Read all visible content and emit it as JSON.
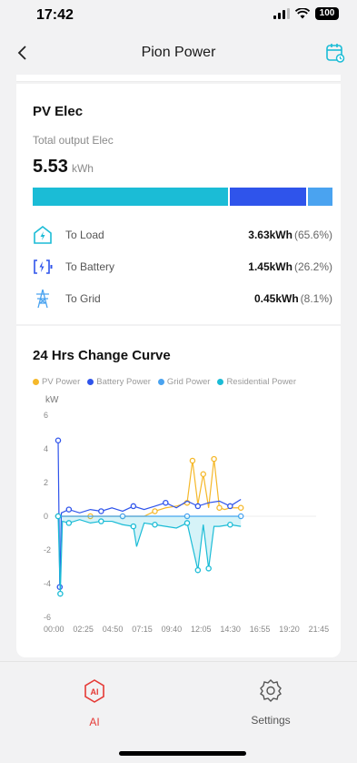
{
  "status_bar": {
    "time": "17:42",
    "battery": "100"
  },
  "header": {
    "title": "Pion Power"
  },
  "pv_card": {
    "title": "PV Elec",
    "subtitle": "Total output Elec",
    "total_value": "5.53",
    "total_unit": "kWh",
    "bar_colors": [
      "#1bbcd6",
      "#2f54eb",
      "#4aa3f0"
    ],
    "bar_fractions": [
      0.656,
      0.262,
      0.081
    ],
    "rows": [
      {
        "label": "To Load",
        "value": "3.63kWh",
        "percent": "(65.6%)",
        "icon": "home-bolt-icon"
      },
      {
        "label": "To Battery",
        "value": "1.45kWh",
        "percent": "(26.2%)",
        "icon": "battery-bolt-icon"
      },
      {
        "label": "To Grid",
        "value": "0.45kWh",
        "percent": "(8.1%)",
        "icon": "power-tower-icon"
      }
    ]
  },
  "curve_card": {
    "title": "24 Hrs Change Curve"
  },
  "chart_data": {
    "type": "line",
    "ylabel": "kW",
    "ylim": [
      -6,
      6
    ],
    "yticks": [
      6,
      4,
      2,
      0,
      -2,
      -4,
      -6
    ],
    "xtick_labels": [
      "00:00",
      "02:25",
      "04:50",
      "07:15",
      "09:40",
      "12:05",
      "14:30",
      "16:55",
      "19:20",
      "21:45"
    ],
    "series": [
      {
        "name": "PV Power",
        "color": "#f5b82a",
        "x": [
          0,
          1,
          2,
          3,
          4,
          5,
          6,
          7,
          8,
          9,
          10,
          11,
          12,
          12.5,
          13,
          13.5,
          14,
          14.5,
          15,
          15.5,
          16,
          17
        ],
        "y": [
          0,
          0,
          0,
          0,
          0,
          0,
          0,
          0,
          0,
          0.3,
          0.5,
          0.6,
          0.8,
          3.3,
          0.7,
          2.5,
          0.5,
          3.4,
          0.5,
          0.4,
          0.5,
          0.5
        ]
      },
      {
        "name": "Battery Power",
        "color": "#2f54eb",
        "x": [
          0,
          0.15,
          0.3,
          1,
          2,
          3,
          4,
          5,
          6,
          7,
          8,
          9,
          10,
          11,
          12,
          13,
          14,
          15,
          16,
          17
        ],
        "y": [
          4.5,
          -4.2,
          0.2,
          0.4,
          0.2,
          0.4,
          0.3,
          0.5,
          0.3,
          0.6,
          0.4,
          0.6,
          0.8,
          0.5,
          0.9,
          0.6,
          0.8,
          0.9,
          0.6,
          1.0
        ]
      },
      {
        "name": "Grid Power",
        "color": "#4aa3f0",
        "x": [
          0,
          2,
          4,
          6,
          8,
          10,
          12,
          14,
          16,
          17
        ],
        "y": [
          0,
          0,
          0,
          0,
          0,
          0,
          0,
          0,
          0,
          0
        ]
      },
      {
        "name": "Residential Power",
        "color": "#1bbcd6",
        "x": [
          0,
          0.2,
          0.4,
          1,
          2,
          3,
          4,
          5,
          6,
          7,
          7.3,
          8,
          9,
          10,
          11,
          12,
          13,
          13.5,
          14,
          14.5,
          15,
          16,
          17
        ],
        "y": [
          0,
          -4.6,
          -0.3,
          -0.4,
          -0.2,
          -0.4,
          -0.3,
          -0.3,
          -0.5,
          -0.6,
          -1.8,
          -0.4,
          -0.5,
          -0.6,
          -0.7,
          -0.4,
          -3.2,
          -0.5,
          -3.1,
          -0.6,
          -0.6,
          -0.5,
          -0.6
        ]
      }
    ]
  },
  "tabbar": {
    "ai_label": "AI",
    "ai_icon_text": "AI",
    "settings_label": "Settings",
    "ai_color": "#e53935"
  }
}
